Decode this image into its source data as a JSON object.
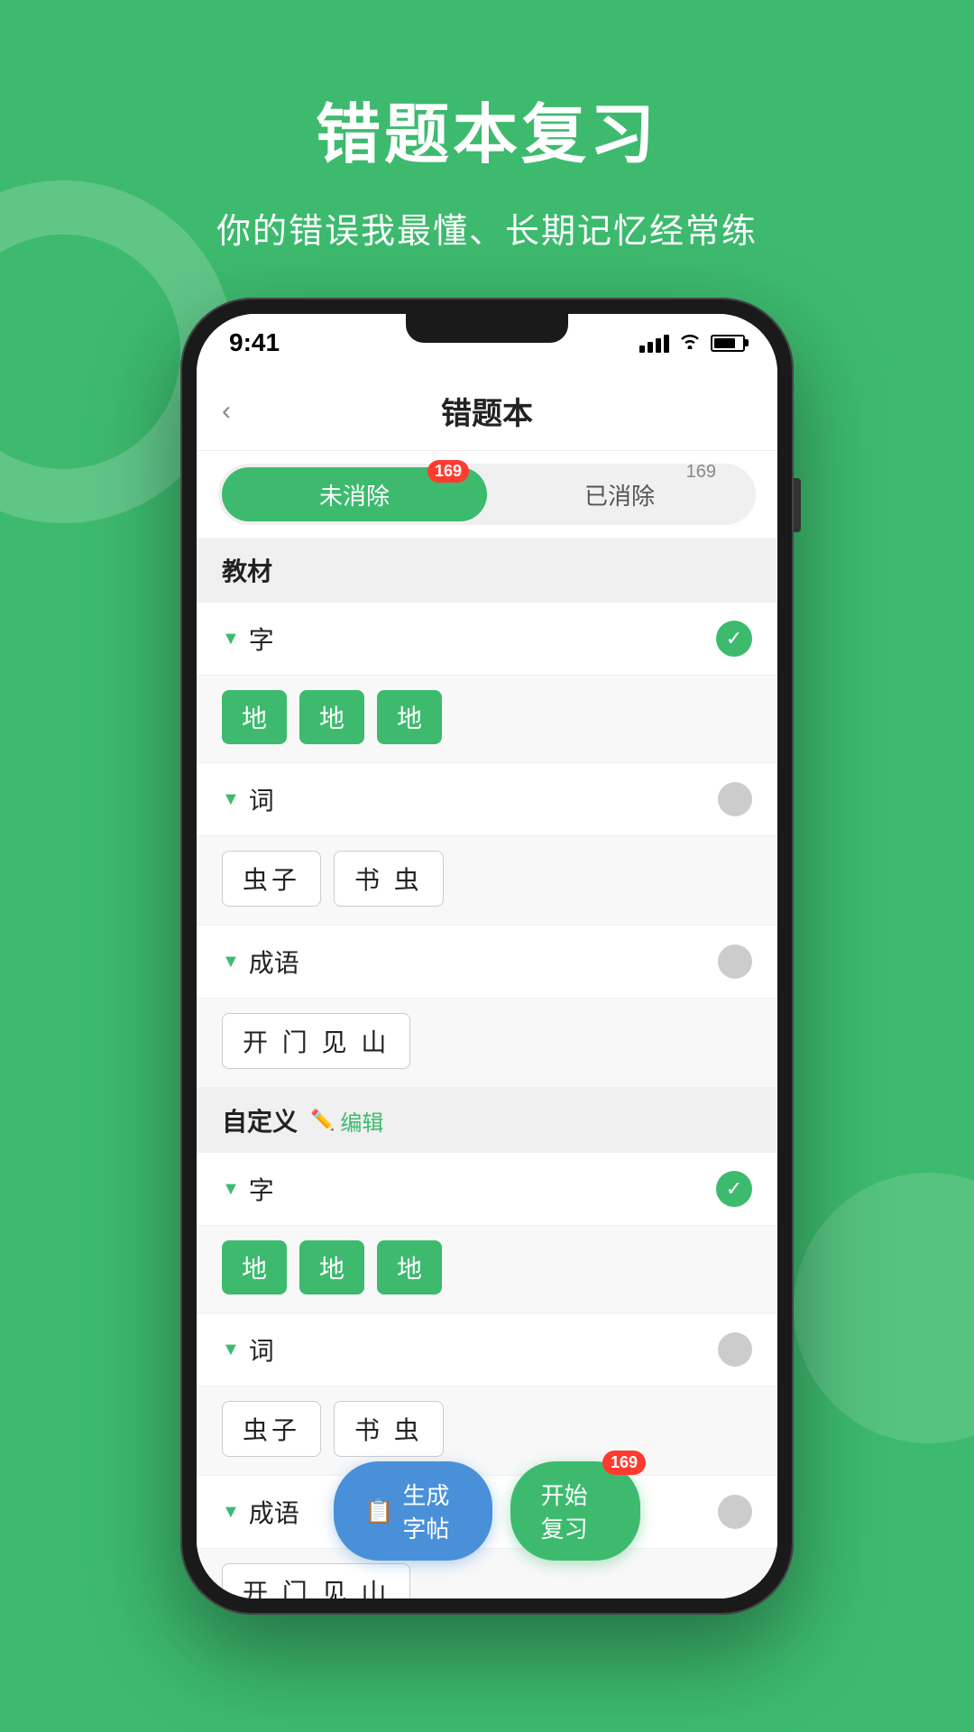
{
  "background_color": "#3dba6e",
  "header": {
    "title": "错题本复习",
    "subtitle": "你的错误我最懂、长期记忆经常练"
  },
  "status_bar": {
    "time": "9:41",
    "signal_bars": [
      8,
      12,
      16,
      20
    ],
    "wifi": "wifi",
    "battery": 75
  },
  "app_header": {
    "back_icon": "‹",
    "title": "错题本"
  },
  "tabs": {
    "active": "未消除",
    "active_badge": "169",
    "inactive": "已消除",
    "inactive_badge": "169"
  },
  "sections": [
    {
      "title": "教材",
      "categories": [
        {
          "name": "字",
          "selected": true,
          "items_type": "green",
          "items": [
            "地",
            "地",
            "地"
          ]
        },
        {
          "name": "词",
          "selected": false,
          "items_type": "outline",
          "items": [
            "虫子",
            "书 虫"
          ]
        },
        {
          "name": "成语",
          "selected": false,
          "items_type": "outline",
          "items": [
            "开 门 见 山"
          ]
        }
      ]
    },
    {
      "title": "自定义",
      "has_edit": true,
      "edit_label": "编辑",
      "categories": [
        {
          "name": "字",
          "selected": true,
          "items_type": "green",
          "items": [
            "地",
            "地",
            "地"
          ]
        },
        {
          "name": "词",
          "selected": false,
          "items_type": "outline",
          "items": [
            "虫子",
            "书 虫"
          ]
        },
        {
          "name": "成语",
          "selected": false,
          "items_type": "outline_partial",
          "items": [
            "开 门 见 山"
          ]
        }
      ]
    }
  ],
  "bottom_buttons": {
    "generate": {
      "icon": "📋",
      "label": "生成字帖"
    },
    "start": {
      "label": "开始复习",
      "badge": "169"
    }
  }
}
